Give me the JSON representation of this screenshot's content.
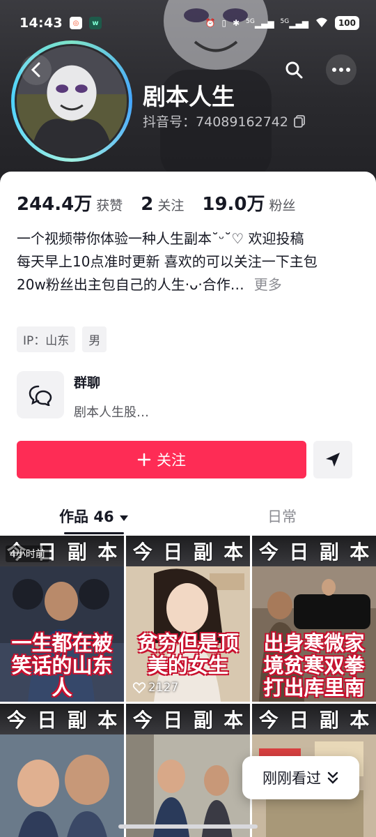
{
  "status_bar": {
    "time": "14:43",
    "battery": "100",
    "network_1": "5G",
    "network_2": "5G"
  },
  "profile": {
    "name": "剧本人生",
    "id_label": "抖音号：",
    "id_value": "74089162742"
  },
  "stats": [
    {
      "value": "244.4万",
      "label": "获赞"
    },
    {
      "value": "2",
      "label": "关注"
    },
    {
      "value": "19.0万",
      "label": "粉丝"
    }
  ],
  "bio": {
    "line1": "一个视频带你体验一种人生副本˘ᵕ˘♡ 欢迎投稿",
    "line2": "每天早上10点准时更新 喜欢的可以关注一下主包",
    "line3": "20w粉丝出主包自己的人生·ᴗ·合作…",
    "more": "更多"
  },
  "tags": [
    "IP：山东",
    "男"
  ],
  "group": {
    "title": "群聊",
    "subtitle": "剧本人生股…"
  },
  "actions": {
    "follow_label": "关注"
  },
  "tabs": {
    "works_label": "作品 46",
    "daily_label": "日常"
  },
  "videos": [
    {
      "header": [
        "今",
        "日",
        "副",
        "本"
      ],
      "caption": "一生都在被笑话的山东人",
      "badge": "4小时前",
      "likes": ""
    },
    {
      "header": [
        "今",
        "日",
        "副",
        "本"
      ],
      "caption": "贫穷但是顶美的女生",
      "badge": "",
      "likes": "2127"
    },
    {
      "header": [
        "今",
        "日",
        "副",
        "本"
      ],
      "caption": "出身寒微家境贫寒双拳打出库里南",
      "badge": "",
      "likes": ""
    },
    {
      "header": [
        "今",
        "日",
        "副",
        "本"
      ],
      "caption": "",
      "badge": "",
      "likes": ""
    },
    {
      "header": [
        "今",
        "日",
        "副",
        "本"
      ],
      "caption": "",
      "badge": "",
      "likes": ""
    },
    {
      "header": [
        "今",
        "日",
        "副",
        "本"
      ],
      "caption": "",
      "badge": "",
      "likes": ""
    }
  ],
  "recent_pill": {
    "label": "刚刚看过"
  },
  "colors": {
    "accent": "#fe2c55",
    "header_bg": "#2a2a2e",
    "caption_stroke": "#c8102e"
  }
}
